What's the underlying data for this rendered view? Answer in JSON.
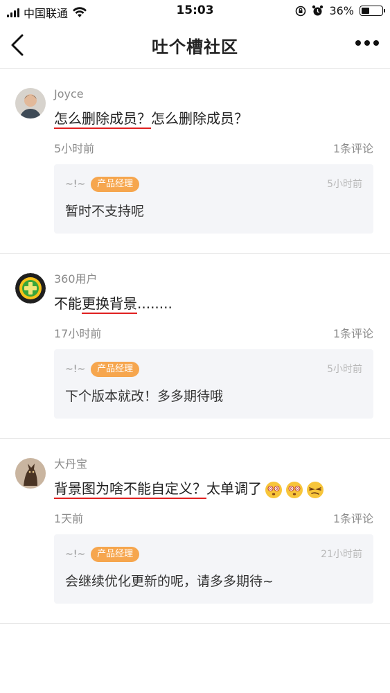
{
  "status_bar": {
    "carrier": "中国联通",
    "time": "15:03",
    "battery": "36%",
    "battery_level": 0.36
  },
  "header": {
    "title": "吐个槽社区"
  },
  "posts": [
    {
      "user": "Joyce",
      "text_underlined": "怎么删除成员？",
      "text_after": "怎么删除成员？",
      "time": "5小时前",
      "comments": "1条评论",
      "reply": {
        "user": "~!~",
        "role": "产品经理",
        "time": "5小时前",
        "text": "暂时不支持呢"
      }
    },
    {
      "user": "360用户",
      "text_before": "不能",
      "text_underlined": "更换背景",
      "text_after": "........",
      "time": "17小时前",
      "comments": "1条评论",
      "reply": {
        "user": "~!~",
        "role": "产品经理",
        "time": "5小时前",
        "text": "下个版本就改！多多期待哦"
      }
    },
    {
      "user": "大丹宝",
      "text_underlined": "背景图为啥不能自定义？",
      "text_after": "太单调了",
      "time": "1天前",
      "comments": "1条评论",
      "reply": {
        "user": "~!~",
        "role": "产品经理",
        "time": "21小时前",
        "text": "会继续优化更新的呢，请多多期待~"
      }
    }
  ],
  "icons": {
    "back": "chevron-left-icon",
    "more": "more-dots-icon",
    "wifi": "wifi-icon",
    "alarm": "alarm-icon",
    "rotation_lock": "rotation-lock-icon",
    "emoji_dizzy": "dizzy-face-emoji",
    "emoji_squint": "squinting-face-emoji"
  }
}
